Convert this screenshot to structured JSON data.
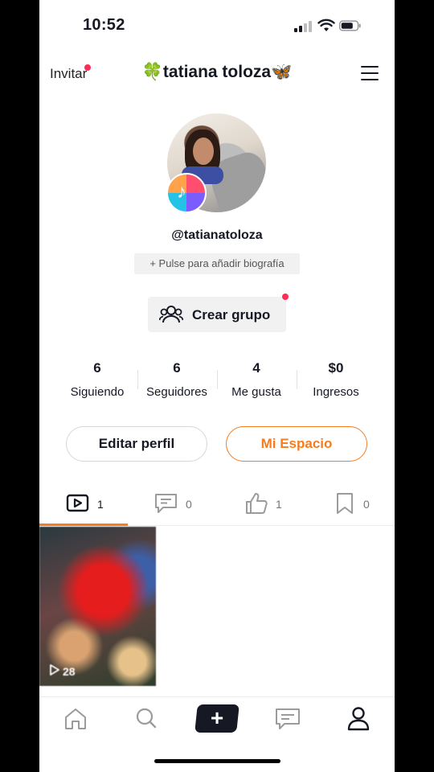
{
  "status_bar": {
    "time": "10:52"
  },
  "header": {
    "invite_label": "Invitar",
    "title": "🍀tatiana toloza🦋",
    "menu_icon": "hamburger-menu-icon"
  },
  "profile": {
    "username": "@tatianatoloza",
    "bio_prompt": "+ Pulse para añadir biografía",
    "create_group_label": "Crear grupo"
  },
  "stats": [
    {
      "value": "6",
      "label": "Siguiendo"
    },
    {
      "value": "6",
      "label": "Seguidores"
    },
    {
      "value": "4",
      "label": "Me gusta"
    },
    {
      "value": "$0",
      "label": "Ingresos"
    }
  ],
  "actions": {
    "edit_profile": "Editar perfil",
    "my_space": "Mi Espacio"
  },
  "tabs": [
    {
      "icon": "video-icon",
      "count": "1"
    },
    {
      "icon": "comment-icon",
      "count": "0"
    },
    {
      "icon": "thumbs-up-icon",
      "count": "1"
    },
    {
      "icon": "bookmark-icon",
      "count": "0"
    }
  ],
  "videos": [
    {
      "views": "28"
    }
  ],
  "colors": {
    "accent": "#f57c1f",
    "notification_dot": "#fe2c55",
    "text": "#161823"
  },
  "bottom_nav": [
    "home-icon",
    "search-icon",
    "add-icon",
    "messages-icon",
    "profile-icon"
  ]
}
